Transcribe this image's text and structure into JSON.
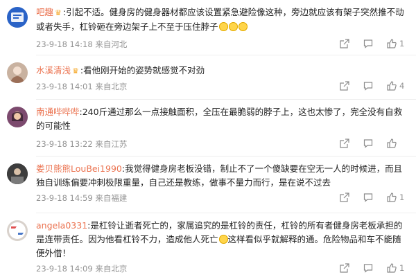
{
  "comments": [
    {
      "user": "吧趣",
      "has_crown": true,
      "content": ":引起不适。健身房的健身器材都应该设置紧急避险像这种，旁边就应该有架子突然推不动或者失手，杠铃砸在旁边架子上不至于压住脖子",
      "emoji_count": 3,
      "time": "23-9-18 14:18",
      "location": "来自河北",
      "likes": "1",
      "avatar_color": "#2a63c7"
    },
    {
      "user": "水溪清浅",
      "has_crown": true,
      "content": ":看他刚开始的姿势就感觉不对劲",
      "emoji_count": 0,
      "time": "23-9-18 14:01",
      "location": "来自北京",
      "likes": "4",
      "avatar_color": "#c9b2a0"
    },
    {
      "user": "南通哔哔哔",
      "has_crown": false,
      "content": ":240斤通过那么一点接触面积，全压在最脆弱的脖子上，这也太惨了，完全没有自救的可能性",
      "emoji_count": 0,
      "time": "23-9-18 13:22",
      "location": "来自江苏",
      "likes": "",
      "avatar_color": "#7c4a6e"
    },
    {
      "user": "娄贝熊熊LouBei1990",
      "has_crown": false,
      "content": ":我觉得健身房老板没错，制止不了一个傻缺要在空无一人的时候进，而且独自训练偏要冲刺极限重量，自己还是教练，做事不量力而行，是在说不过去",
      "emoji_count": 0,
      "time": "23-9-18 14:59",
      "location": "来自福建",
      "likes": "1",
      "avatar_color": "#5a5a5a"
    },
    {
      "user": "angela0331",
      "has_crown": false,
      "content_a": ":是杠铃让逝者死亡的，家属追究的是杠铃的责任，杠铃的所有者健身房老板承担的是连带责任。因为他看杠铃不力，造成他人死亡",
      "content_b": "这样看似乎就解释的通。危险物品和车不能随便外借！",
      "emoji_count": 1,
      "time": "23-9-18 14:09",
      "location": "来自北京",
      "likes": "1",
      "avatar_color": "#d9d2cc"
    }
  ],
  "icons": {
    "share": "share-icon",
    "comment": "comment-icon",
    "like": "like-icon",
    "crown": "crown-icon"
  },
  "colors": {
    "username": "#eb7350",
    "meta": "#939393",
    "text": "#222222"
  }
}
